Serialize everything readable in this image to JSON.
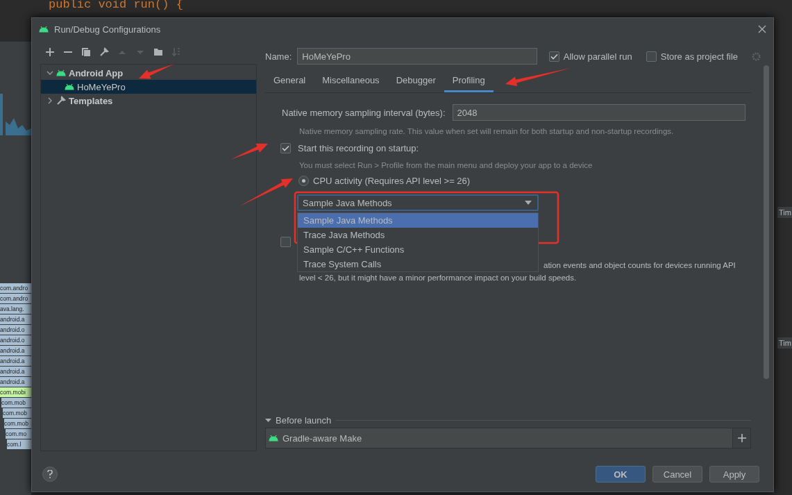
{
  "background": {
    "code_line": "public void run() {",
    "flame_rows": [
      {
        "label": "com.andro",
        "color": "#a9bfd3"
      },
      {
        "label": "com.andro",
        "color": "#a9bfd3"
      },
      {
        "label": "ava.lang.",
        "color": "#a9bfd3"
      },
      {
        "label": "android.a",
        "color": "#a9bfd3"
      },
      {
        "label": "android.o",
        "color": "#a9bfd3"
      },
      {
        "label": "android.o",
        "color": "#a9bfd3"
      },
      {
        "label": "android.a",
        "color": "#a9bfd3"
      },
      {
        "label": "android.a",
        "color": "#a9bfd3"
      },
      {
        "label": "android.a",
        "color": "#a9bfd3"
      },
      {
        "label": "android.a",
        "color": "#a9bfd3"
      },
      {
        "label": "com.mobi",
        "color": "#c6f5a6"
      },
      {
        "label": "com.mob",
        "color": "#a9bfd3"
      },
      {
        "label": "com.mob",
        "color": "#a9bfd3"
      },
      {
        "label": "com.mob",
        "color": "#a9bfd3"
      },
      {
        "label": "com.mo",
        "color": "#a9bfd3"
      },
      {
        "label": "com.l",
        "color": "#a9bfd3"
      }
    ],
    "side_labels": [
      "Tim",
      "Tim"
    ]
  },
  "dialog": {
    "title": "Run/Debug Configurations"
  },
  "toolbar": [
    {
      "kind": "add",
      "disabled": false
    },
    {
      "kind": "remove",
      "disabled": false
    },
    {
      "kind": "copy",
      "disabled": false
    },
    {
      "kind": "wrench",
      "disabled": false
    },
    {
      "kind": "up",
      "disabled": true
    },
    {
      "kind": "down",
      "disabled": true
    },
    {
      "kind": "folder",
      "disabled": false
    },
    {
      "kind": "sort",
      "disabled": true
    }
  ],
  "tree": [
    {
      "label": "Android App",
      "kind": "android",
      "expanded": true,
      "selected": false,
      "children": [
        {
          "label": "HoMeYePro",
          "kind": "android",
          "selected": false,
          "current": true
        }
      ]
    },
    {
      "label": "Templates",
      "kind": "wrench",
      "expanded": false,
      "selected": false
    }
  ],
  "name_field": {
    "label": "Name:",
    "value": "HoMeYePro"
  },
  "header_options": [
    {
      "label": "Allow parallel run",
      "checked": true
    },
    {
      "label": "Store as project file",
      "checked": false
    }
  ],
  "tabs": [
    {
      "label": "General",
      "selected": false
    },
    {
      "label": "Miscellaneous",
      "selected": false
    },
    {
      "label": "Debugger",
      "selected": false
    },
    {
      "label": "Profiling",
      "selected": true
    }
  ],
  "profiling": {
    "interval_label": "Native memory sampling interval (bytes):",
    "interval_value": "2048",
    "interval_hint": "Native memory sampling rate. This value when set will remain for both startup and non-startup recordings.",
    "startup": {
      "label": "Start this recording on startup:",
      "checked": true
    },
    "startup_hint": "You must select Run > Profile from the main menu and deploy your app to a device",
    "cpu": {
      "label": "CPU activity (Requires API level >= 26)",
      "selected": true
    },
    "cpu_select": {
      "value": "Sample Java Methods",
      "open": true,
      "options": [
        {
          "label": "Sample Java Methods",
          "selected": true
        },
        {
          "label": "Trace Java Methods",
          "selected": false
        },
        {
          "label": "Sample C/C++ Functions",
          "selected": false
        },
        {
          "label": "Trace System Calls",
          "selected": false
        }
      ]
    },
    "memory": {
      "checked": false,
      "line_1": "ation events and object counts for devices running API",
      "line_2": "level < 26, but it might have a minor performance impact on your build speeds."
    }
  },
  "before_launch": {
    "title": "Before launch",
    "expanded": true,
    "tasks": [
      {
        "label": "Gradle-aware Make"
      }
    ]
  },
  "buttons": [
    {
      "label": "OK",
      "kind": "primary"
    },
    {
      "label": "Cancel",
      "kind": "default"
    },
    {
      "label": "Apply",
      "kind": "default"
    }
  ]
}
